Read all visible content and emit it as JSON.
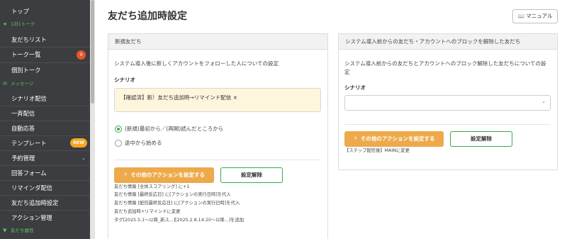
{
  "sidebar": {
    "items": [
      {
        "label": "トップ"
      },
      {
        "label": "友だちリスト"
      },
      {
        "label": "トーク一覧",
        "badge": "9"
      },
      {
        "label": "個別トーク"
      },
      {
        "label": "シナリオ配信"
      },
      {
        "label": "一斉配信"
      },
      {
        "label": "自動応答"
      },
      {
        "label": "テンプレート",
        "badge": "NEW"
      },
      {
        "label": "予約管理"
      },
      {
        "label": "回答フォーム"
      },
      {
        "label": "リマインダ配信"
      },
      {
        "label": "友だち追加時設定"
      },
      {
        "label": "アクション管理"
      }
    ],
    "sections": [
      "1対1トーク",
      "メッセージ",
      "友だち属性"
    ]
  },
  "header": {
    "title": "友だち追加時設定",
    "manual_label": "マニュアル"
  },
  "left_card": {
    "title": "新規友だち",
    "description": "システム導入後に新しくアカウントをフォローした人についての設定",
    "scenario_label": "シナリオ",
    "scenario_value": "【確認済】新）友だち追加時→リマインド配信",
    "remove_mark": "×",
    "radio_options": [
      "(新規)最初から／(再開)読んだところから",
      "途中から始める"
    ],
    "action_button": "その他のアクションを設定する",
    "unset_button": "設定解除",
    "action_lines": [
      "友だち情報 [全体スコアリング] に+1",
      "友だち情報 [最終反応日] に[アクションの実行日時]を代入",
      "友だち情報 [配信最終反応日] に[アクションの実行日時]を代入",
      "友だち追加時+リマインドに変更",
      "タグ[2025.5.1〜以降_新ス...][2025.2.8.14:20〜以降...]を追加"
    ]
  },
  "right_card": {
    "title": "システム導入前からの友だち・アカウントへのブロックを解除した友だち",
    "description_line1": "システム導入前からの友だちとアカウントへのブロック解除した友だちについての設",
    "description_line2": "定",
    "scenario_label": "シナリオ",
    "action_button": "その他のアクションを設定する",
    "unset_button": "設定解除",
    "action_line": "【ステップ配信後】MAINに変更"
  },
  "colors": {
    "sidebar_bg": "#3b3d40",
    "accent_green": "#3aa84a",
    "accent_orange": "#eda94a",
    "badge_red": "#e8542a"
  }
}
